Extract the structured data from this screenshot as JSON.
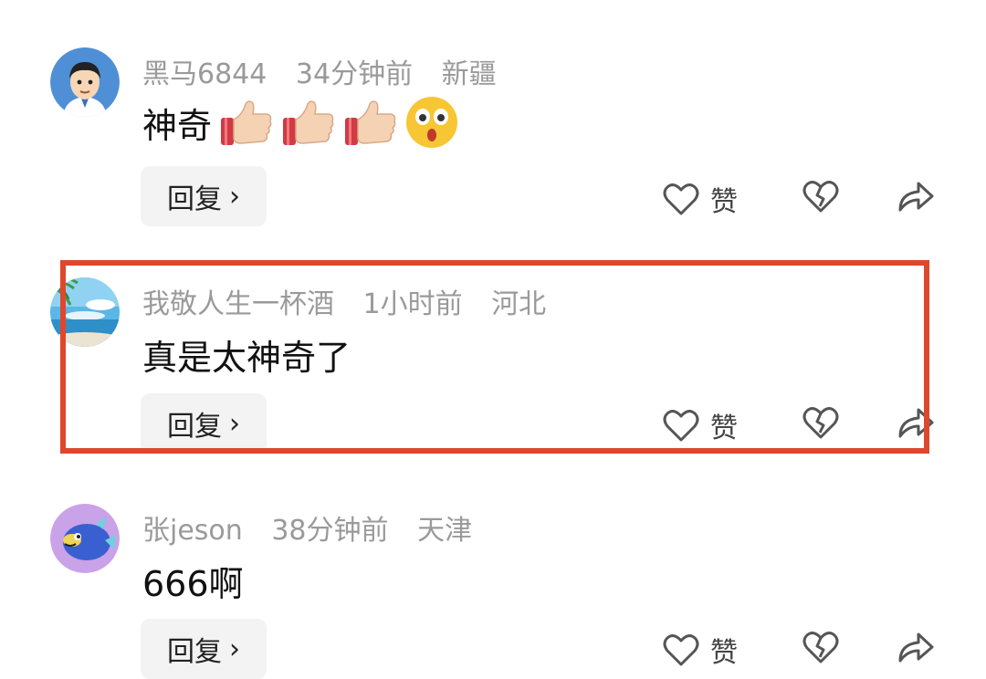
{
  "comments": [
    {
      "username": "黑马6844",
      "time": "34分钟前",
      "location": "新疆",
      "text": "神奇",
      "emojis": [
        "thumbs-up-emoji",
        "thumbs-up-emoji",
        "thumbs-up-emoji",
        "astonished-face-emoji"
      ],
      "reply_label": "回复",
      "like_label": "赞"
    },
    {
      "username": "我敬人生一杯酒",
      "time": "1小时前",
      "location": "河北",
      "text": "真是太神奇了",
      "reply_label": "回复",
      "like_label": "赞"
    },
    {
      "username": "张jeson",
      "time": "38分钟前",
      "location": "天津",
      "text": "666啊",
      "reply_label": "回复",
      "like_label": "赞"
    }
  ],
  "highlight_color": "#e0462d"
}
